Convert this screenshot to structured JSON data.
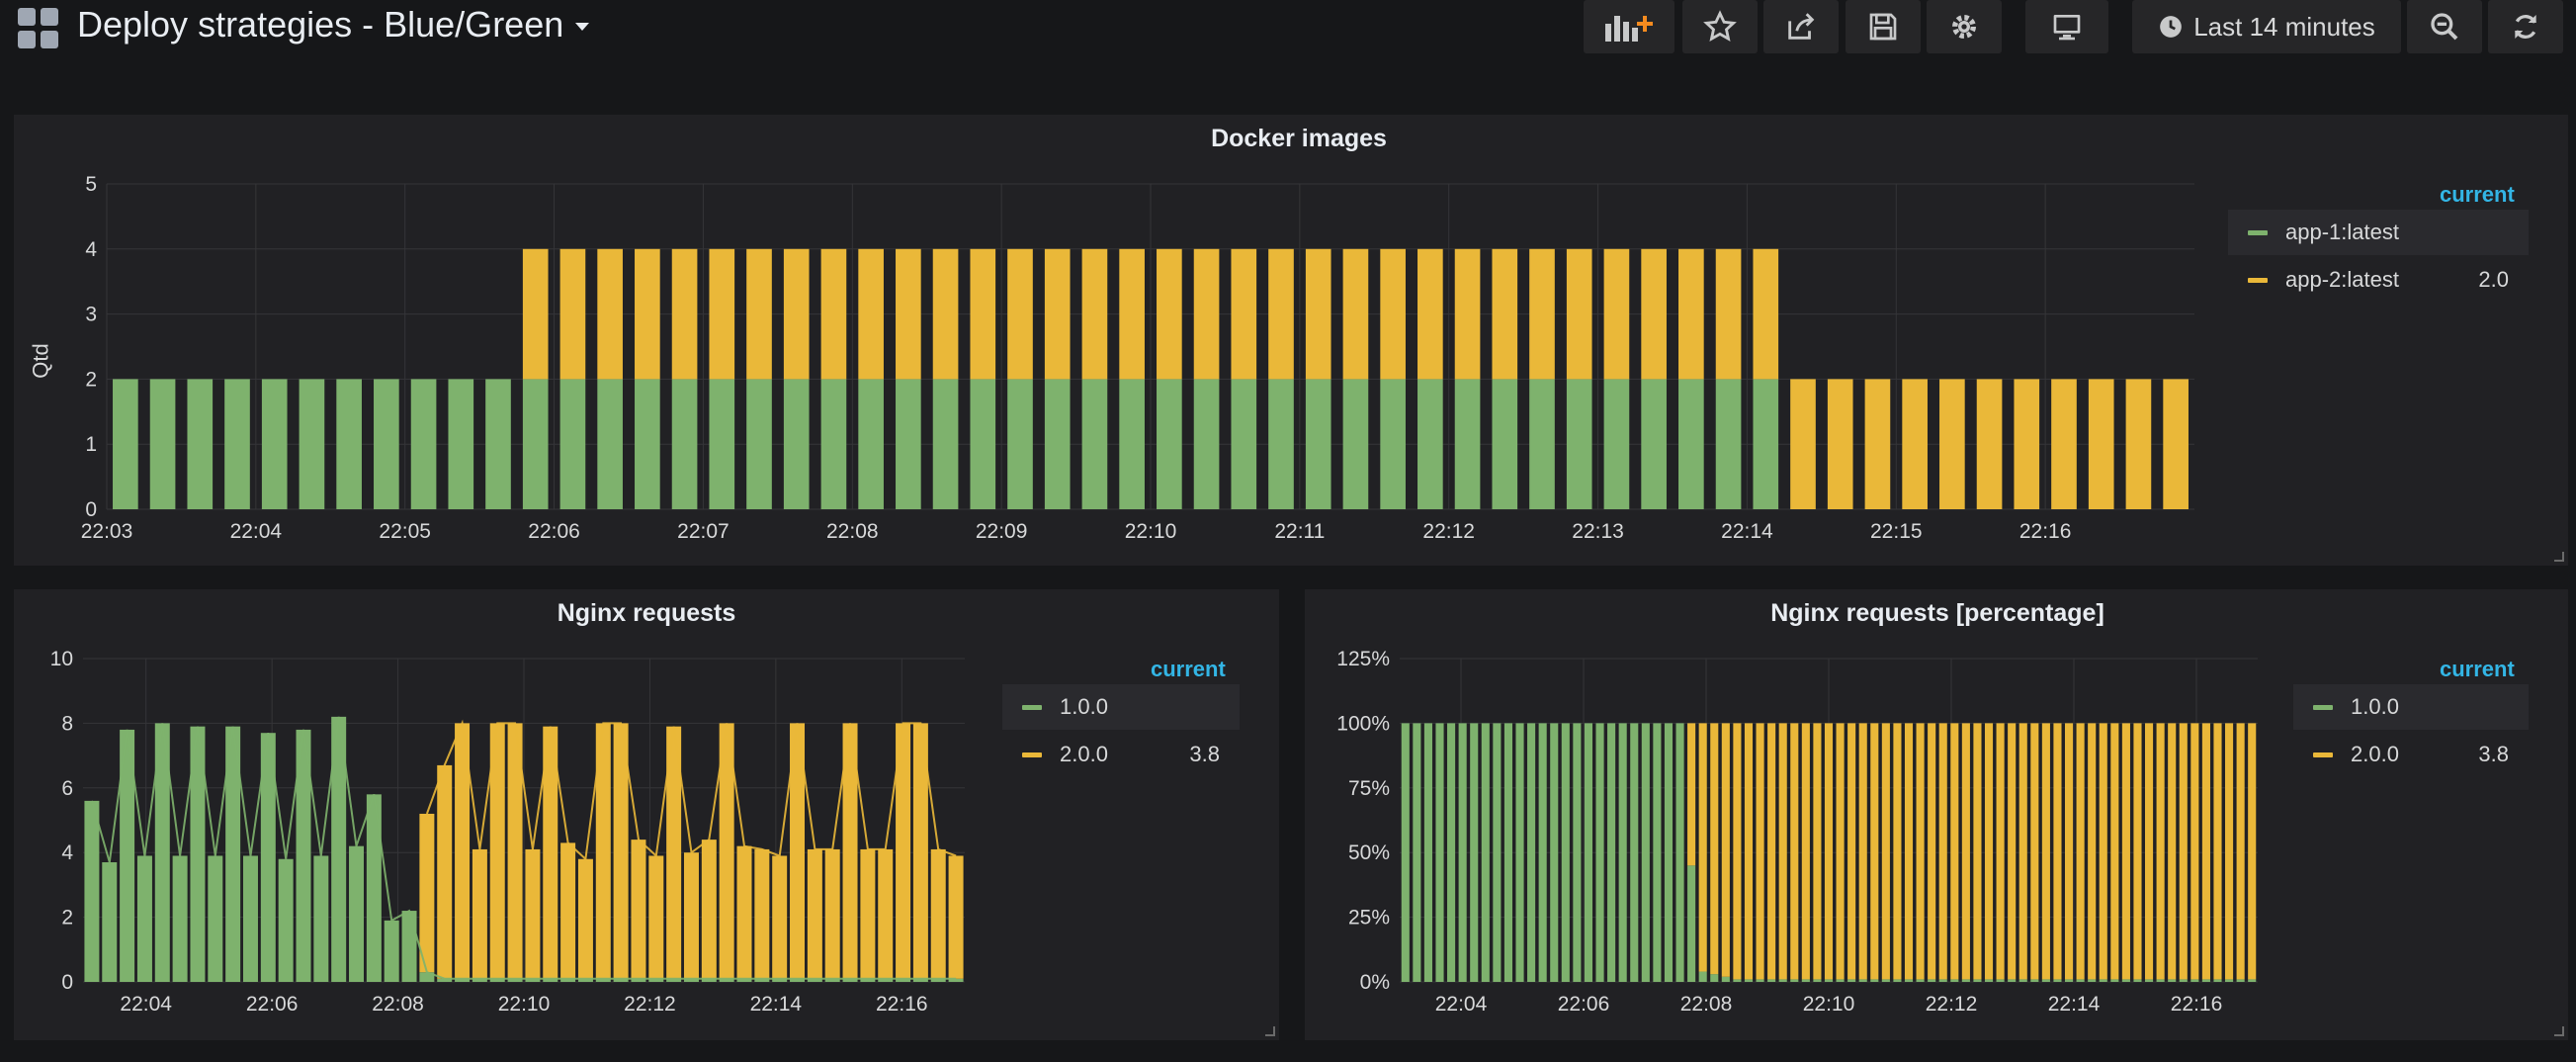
{
  "header": {
    "title": "Deploy strategies - Blue/Green",
    "time_range": "Last 14 minutes"
  },
  "toolbar": {
    "buttons": [
      "add-panel-icon",
      "star-icon",
      "share-icon",
      "save-icon",
      "settings-icon",
      "tv-mode-icon",
      "clock-icon",
      "zoom-out-icon",
      "refresh-icon"
    ]
  },
  "colors": {
    "green": "#7eb26d",
    "yellow": "#eab839",
    "bg": "#161719",
    "panel": "#212124",
    "grid": "#353538",
    "accent": "#33b5e5"
  },
  "panels": {
    "docker": {
      "title": "Docker images",
      "ylabel": "Qtd",
      "legend_header": "current",
      "legend": [
        {
          "name": "app-1:latest",
          "value": "",
          "color": "#7eb26d"
        },
        {
          "name": "app-2:latest",
          "value": "2.0",
          "color": "#eab839"
        }
      ]
    },
    "nginx": {
      "title": "Nginx requests",
      "legend_header": "current",
      "legend": [
        {
          "name": "1.0.0",
          "value": "",
          "color": "#7eb26d"
        },
        {
          "name": "2.0.0",
          "value": "3.8",
          "color": "#eab839"
        }
      ]
    },
    "nginx_pct": {
      "title": "Nginx requests [percentage]",
      "legend_header": "current",
      "legend": [
        {
          "name": "1.0.0",
          "value": "",
          "color": "#7eb26d"
        },
        {
          "name": "2.0.0",
          "value": "3.8",
          "color": "#eab839"
        }
      ]
    }
  },
  "chart_data": [
    {
      "type": "bar",
      "stacked": true,
      "title": "Docker images",
      "ylabel": "Qtd",
      "ylim": [
        0,
        5
      ],
      "yticks": [
        "0",
        "1",
        "2",
        "3",
        "4",
        "5"
      ],
      "xlabels": [
        "22:03",
        "22:04",
        "22:05",
        "22:06",
        "22:07",
        "22:08",
        "22:09",
        "22:10",
        "22:11",
        "22:12",
        "22:13",
        "22:14",
        "22:15",
        "22:16"
      ],
      "xrange": [
        "22:03",
        "22:17"
      ],
      "bar_count": 56,
      "series": [
        {
          "name": "app-1:latest",
          "values": [
            2,
            2,
            2,
            2,
            2,
            2,
            2,
            2,
            2,
            2,
            2,
            2,
            2,
            2,
            2,
            2,
            2,
            2,
            2,
            2,
            2,
            2,
            2,
            2,
            2,
            2,
            2,
            2,
            2,
            2,
            2,
            2,
            2,
            2,
            2,
            2,
            2,
            2,
            2,
            2,
            2,
            2,
            2,
            2,
            2,
            0,
            0,
            0,
            0,
            0,
            0,
            0,
            0,
            0,
            0,
            0
          ]
        },
        {
          "name": "app-2:latest",
          "values": [
            0,
            0,
            0,
            0,
            0,
            0,
            0,
            0,
            0,
            0,
            0,
            2,
            2,
            2,
            2,
            2,
            2,
            2,
            2,
            2,
            2,
            2,
            2,
            2,
            2,
            2,
            2,
            2,
            2,
            2,
            2,
            2,
            2,
            2,
            2,
            2,
            2,
            2,
            2,
            2,
            2,
            2,
            2,
            2,
            2,
            2,
            2,
            2,
            2,
            2,
            2,
            2,
            2,
            2,
            2,
            2
          ]
        }
      ],
      "grid": true,
      "legend_position": "right"
    },
    {
      "type": "bar",
      "stacked": true,
      "title": "Nginx requests",
      "ylim": [
        0,
        10
      ],
      "yticks": [
        "0",
        "2",
        "4",
        "6",
        "8",
        "10"
      ],
      "xlabels": [
        "22:04",
        "22:06",
        "22:08",
        "22:10",
        "22:12",
        "22:14",
        "22:16"
      ],
      "xrange": [
        "22:03",
        "22:17"
      ],
      "series": [
        {
          "name": "1.0.0",
          "values": [
            5.6,
            3.7,
            7.8,
            3.9,
            8.0,
            3.9,
            7.9,
            3.9,
            7.9,
            3.9,
            7.7,
            3.8,
            7.8,
            3.9,
            8.2,
            4.2,
            5.8,
            1.9,
            2.2,
            0.3,
            0.1,
            0.1,
            0.1,
            0.1,
            0.1,
            0.1,
            0.1,
            0.1,
            0.1,
            0.1,
            0.1,
            0.1,
            0.1,
            0.1,
            0.1,
            0.1,
            0.1,
            0.1,
            0.1,
            0.1,
            0.1,
            0.1,
            0.1,
            0.1,
            0.1,
            0.1,
            0.1,
            0.1,
            0.1,
            0.1
          ]
        },
        {
          "name": "2.0.0",
          "values": [
            0,
            0,
            0,
            0,
            0,
            0,
            0,
            0,
            0,
            0,
            0,
            0,
            0,
            0,
            0,
            0,
            0,
            0,
            0,
            4.9,
            6.6,
            7.9,
            4.0,
            7.9,
            7.9,
            4.0,
            7.8,
            4.2,
            3.7,
            7.9,
            7.9,
            4.3,
            3.8,
            7.8,
            3.9,
            4.3,
            7.9,
            4.1,
            4.0,
            3.8,
            7.9,
            4.0,
            4.0,
            7.9,
            4.0,
            4.0,
            7.9,
            7.9,
            4.0,
            3.8
          ]
        }
      ],
      "grid": true,
      "legend_position": "right"
    },
    {
      "type": "bar",
      "stacked": true,
      "title": "Nginx requests [percentage]",
      "ylim": [
        0,
        125
      ],
      "yticks": [
        "0%",
        "25%",
        "50%",
        "75%",
        "100%",
        "125%"
      ],
      "xlabels": [
        "22:04",
        "22:06",
        "22:08",
        "22:10",
        "22:12",
        "22:14",
        "22:16"
      ],
      "xrange": [
        "22:03",
        "22:17"
      ],
      "series": [
        {
          "name": "1.0.0",
          "values": [
            100,
            100,
            100,
            100,
            100,
            100,
            100,
            100,
            100,
            100,
            100,
            100,
            100,
            100,
            100,
            100,
            100,
            100,
            100,
            100,
            100,
            100,
            100,
            100,
            100,
            45,
            4,
            3,
            2,
            1,
            1,
            1,
            1,
            1,
            1,
            1,
            1,
            1,
            1,
            1,
            1,
            1,
            1,
            1,
            1,
            1,
            1,
            1,
            1,
            1,
            1,
            1,
            1,
            1,
            1,
            1,
            1,
            1,
            1,
            1,
            1,
            1,
            1,
            1,
            1,
            1,
            1,
            1,
            1,
            1,
            1,
            1,
            1,
            1,
            1
          ]
        },
        {
          "name": "2.0.0",
          "values": [
            0,
            0,
            0,
            0,
            0,
            0,
            0,
            0,
            0,
            0,
            0,
            0,
            0,
            0,
            0,
            0,
            0,
            0,
            0,
            0,
            0,
            0,
            0,
            0,
            0,
            55,
            96,
            97,
            98,
            99,
            99,
            99,
            99,
            99,
            99,
            99,
            99,
            99,
            99,
            99,
            99,
            99,
            99,
            99,
            99,
            99,
            99,
            99,
            99,
            99,
            99,
            99,
            99,
            99,
            99,
            99,
            99,
            99,
            99,
            99,
            99,
            99,
            99,
            99,
            99,
            99,
            99,
            99,
            99,
            99,
            99,
            99,
            99,
            99,
            99
          ]
        }
      ],
      "grid": true,
      "legend_position": "right"
    }
  ]
}
